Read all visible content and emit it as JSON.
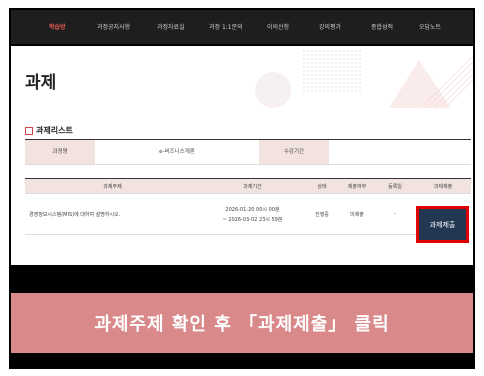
{
  "nav": {
    "items": [
      "학습방",
      "과정공지사항",
      "과정자료실",
      "과정 1:1문의",
      "이의신청",
      "강의평가",
      "종합성적",
      "오답노트"
    ],
    "active_color": "#e55a52"
  },
  "page": {
    "title": "과제"
  },
  "section": {
    "title": "과제리스트"
  },
  "course_info": {
    "course_label": "과정명",
    "course_value": "e-비즈니스개론",
    "period_label": "수강기간",
    "period_value": ""
  },
  "table": {
    "headers": [
      "과제주제",
      "과제기간",
      "상태",
      "제출여부",
      "등록일",
      "과제제출"
    ],
    "row": {
      "topic": "경영정보시스템(MIS)에 대하여 설명하시오.",
      "period_start": "2026-01-20 00시 00분",
      "period_end": "~ 2026-03-02 23시 59분",
      "status": "진행중",
      "submitted": "미제출",
      "registered": "-",
      "submit_label": "과제제출"
    }
  },
  "caption": "과제주제 확인 후 「과제제출」 클릭",
  "colors": {
    "highlight": "#e00000",
    "button": "#223852",
    "caption_bg": "#d98989"
  }
}
